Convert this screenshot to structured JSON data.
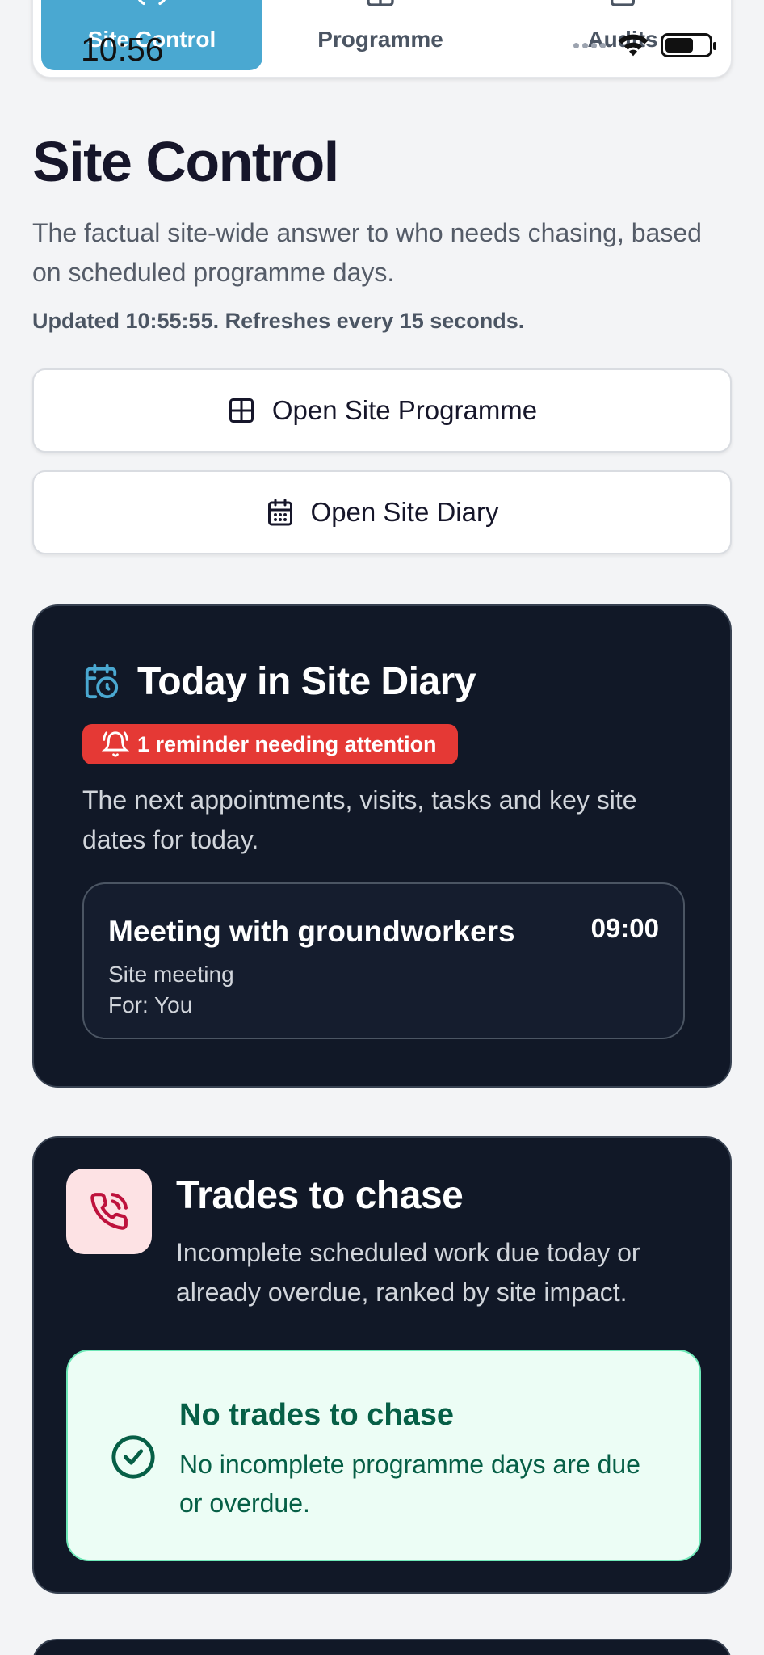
{
  "status_bar": {
    "time": "10:56"
  },
  "tabs": [
    {
      "label": "Site Control",
      "active": true
    },
    {
      "label": "Programme",
      "active": false
    },
    {
      "label": "Audits",
      "active": false
    }
  ],
  "header": {
    "title": "Site Control",
    "subtitle": "The factual site-wide answer to who needs chasing, based on scheduled programme days.",
    "updated": "Updated 10:55:55. Refreshes every 15 seconds."
  },
  "actions": {
    "open_programme": "Open Site Programme",
    "open_diary": "Open Site Diary"
  },
  "diary": {
    "title": "Today in Site Diary",
    "reminder_badge": "1 reminder needing attention",
    "description": "The next appointments, visits, tasks and key site dates for today.",
    "appointments": [
      {
        "title": "Meeting with groundworkers",
        "time": "09:00",
        "type": "Site meeting",
        "for": "For: You"
      }
    ]
  },
  "trades": {
    "title": "Trades to chase",
    "description": "Incomplete scheduled work due today or already overdue, ranked by site impact.",
    "empty_title": "No trades to chase",
    "empty_description": "No incomplete programme days are due or overdue."
  },
  "colors": {
    "accent": "#4aa8d1",
    "card_bg": "#111827",
    "alert": "#e53935",
    "success_bg": "#ecfdf5",
    "success_text": "#065f46"
  }
}
